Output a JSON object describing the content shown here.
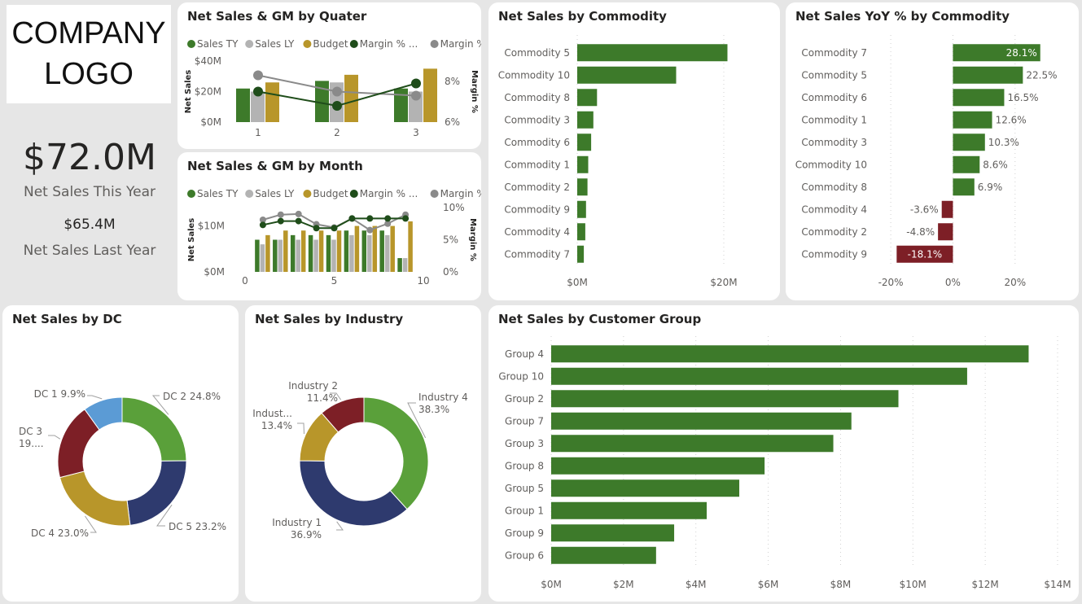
{
  "logo": {
    "line1": "COMPANY",
    "line2": "LOGO"
  },
  "kpi": {
    "main_value": "$72.0M",
    "main_label": "Net Sales This Year",
    "secondary_value": "$65.4M",
    "secondary_label": "Net Sales Last Year"
  },
  "colors": {
    "sales_ty": "#3d7a2a",
    "sales_ly": "#b3b3b3",
    "budget": "#b8962a",
    "margin_ty": "#1f4d1a",
    "margin_ly": "#8a8a8a",
    "bar": "#3d7a2a",
    "negative": "#7d1f26",
    "dc1": "#5b9bd5",
    "dc2": "#5aa03a",
    "dc3": "#7d1f26",
    "dc4": "#b8962a",
    "dc5": "#2e3a6e"
  },
  "legend": [
    "Sales TY",
    "Sales LY",
    "Budget",
    "Margin % ...",
    "Margin %..."
  ],
  "chart_data": [
    {
      "id": "quarter",
      "type": "bar",
      "title": "Net Sales & GM by Quater",
      "ylabel": "Net Sales",
      "y2label": "Margin %",
      "categories": [
        "1",
        "2",
        "3"
      ],
      "yticks": [
        "$40M",
        "$20M",
        "$0M"
      ],
      "y2ticks": [
        "8%",
        "6%"
      ],
      "ylim": [
        0,
        40
      ],
      "y2lim": [
        6,
        9
      ],
      "series": [
        {
          "name": "Sales TY",
          "values": [
            22,
            27,
            22
          ]
        },
        {
          "name": "Sales LY",
          "values": [
            20,
            26,
            20
          ]
        },
        {
          "name": "Budget",
          "values": [
            26,
            31,
            35
          ]
        }
      ],
      "lines": [
        {
          "name": "Margin % ...",
          "values": [
            7.5,
            6.8,
            7.9
          ]
        },
        {
          "name": "Margin %...",
          "values": [
            8.3,
            7.5,
            7.3
          ]
        }
      ]
    },
    {
      "id": "month",
      "type": "bar",
      "title": "Net Sales & GM by Month",
      "ylabel": "Net Sales",
      "y2label": "Margin %",
      "x": [
        1,
        2,
        3,
        4,
        5,
        6,
        7,
        8,
        9
      ],
      "xticks": [
        "0",
        "5",
        "10"
      ],
      "yticks": [
        "$10M",
        "$0M"
      ],
      "y2ticks": [
        "10%",
        "5%",
        "0%"
      ],
      "series": [
        {
          "name": "Sales TY",
          "values": [
            7,
            7,
            8,
            8,
            8,
            9,
            9,
            9,
            3
          ]
        },
        {
          "name": "Sales LY",
          "values": [
            6,
            7,
            7,
            7,
            7,
            8,
            8,
            8,
            3
          ]
        },
        {
          "name": "Budget",
          "values": [
            8,
            9,
            9,
            9,
            9,
            10,
            10,
            10,
            11
          ]
        }
      ],
      "lines": [
        {
          "name": "Margin % ...",
          "values": [
            7.3,
            7.9,
            7.9,
            6.8,
            6.8,
            8.3,
            8.3,
            8.3,
            8.3
          ]
        },
        {
          "name": "Margin %...",
          "values": [
            8.1,
            8.9,
            9.0,
            7.4,
            6.9,
            8.3,
            6.5,
            7.5,
            8.9
          ]
        }
      ]
    },
    {
      "id": "commodity",
      "type": "bar",
      "orientation": "horizontal",
      "title": "Net Sales by Commodity",
      "categories": [
        "Commodity 5",
        "Commodity 10",
        "Commodity 8",
        "Commodity 3",
        "Commodity 6",
        "Commodity 1",
        "Commodity 2",
        "Commodity 9",
        "Commodity 4",
        "Commodity 7"
      ],
      "values": [
        20.5,
        13.5,
        2.7,
        2.2,
        1.9,
        1.5,
        1.4,
        1.2,
        1.1,
        0.9
      ],
      "xticks": [
        "$0M",
        "$20M"
      ],
      "xlim": [
        0,
        24
      ]
    },
    {
      "id": "yoy",
      "type": "bar",
      "orientation": "horizontal",
      "title": "Net Sales YoY % by Commodity",
      "categories": [
        "Commodity 7",
        "Commodity 5",
        "Commodity 6",
        "Commodity 1",
        "Commodity 3",
        "Commodity 10",
        "Commodity 8",
        "Commodity 4",
        "Commodity 2",
        "Commodity 9"
      ],
      "values": [
        28.1,
        22.5,
        16.5,
        12.6,
        10.3,
        8.6,
        6.9,
        -3.6,
        -4.8,
        -18.1
      ],
      "labels": [
        "28.1%",
        "22.5%",
        "16.5%",
        "12.6%",
        "10.3%",
        "8.6%",
        "6.9%",
        "-3.6%",
        "-4.8%",
        "-18.1%"
      ],
      "xticks": [
        "-20%",
        "0%",
        "20%"
      ],
      "xlim": [
        -25,
        30
      ]
    },
    {
      "id": "dc",
      "type": "pie",
      "title": "Net Sales by DC",
      "slices": [
        {
          "name": "DC 2",
          "value": 24.8,
          "label": "DC 2 24.8%"
        },
        {
          "name": "DC 5",
          "value": 23.2,
          "label": "DC 5 23.2%"
        },
        {
          "name": "DC 4",
          "value": 23.0,
          "label": "DC 4 23.0%"
        },
        {
          "name": "DC 3",
          "value": 19.1,
          "label": "DC 3 19...."
        },
        {
          "name": "DC 1",
          "value": 9.9,
          "label": "DC 1 9.9%"
        }
      ]
    },
    {
      "id": "industry",
      "type": "pie",
      "title": "Net Sales by Industry",
      "slices": [
        {
          "name": "Industry 4",
          "value": 38.3,
          "label": "Industry 4 38.3%"
        },
        {
          "name": "Industry 1",
          "value": 36.9,
          "label": "Industry 1 36.9%"
        },
        {
          "name": "Industry 3",
          "value": 13.4,
          "label": "Indust... 13.4%"
        },
        {
          "name": "Industry 2",
          "value": 11.4,
          "label": "Industry 2 11.4%"
        }
      ]
    },
    {
      "id": "customer",
      "type": "bar",
      "orientation": "horizontal",
      "title": "Net Sales by Customer Group",
      "categories": [
        "Group 4",
        "Group 10",
        "Group 2",
        "Group 7",
        "Group 3",
        "Group 8",
        "Group 5",
        "Group 1",
        "Group 9",
        "Group 6"
      ],
      "values": [
        13.2,
        11.5,
        9.6,
        8.3,
        7.8,
        5.9,
        5.2,
        4.3,
        3.4,
        2.9
      ],
      "xticks": [
        "$0M",
        "$2M",
        "$4M",
        "$6M",
        "$8M",
        "$10M",
        "$12M",
        "$14M"
      ],
      "xlim": [
        0,
        14
      ]
    }
  ]
}
